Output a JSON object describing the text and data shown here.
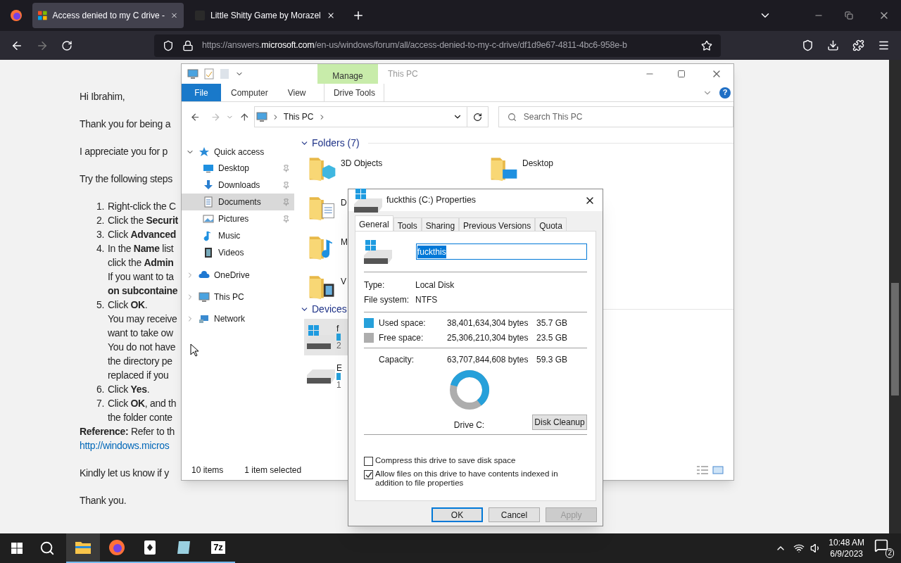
{
  "browser": {
    "tabs": [
      {
        "title": "Access denied to my C drive -",
        "selected": true,
        "kind": "ms"
      },
      {
        "title": "Little Shitty Game by Morazel",
        "selected": false,
        "kind": "game"
      }
    ],
    "url": {
      "before": "https://answers.",
      "domain": "microsoft.com",
      "after": "/en-us/windows/forum/all/access-denied-to-my-c-drive/df1d9e67-4811-4bc6-958e-b"
    }
  },
  "article": [
    {
      "kind": "para",
      "text": "Hi Ibrahim,"
    },
    {
      "kind": "para",
      "text": "Thank you for being a"
    },
    {
      "kind": "para",
      "text": "I appreciate you for p"
    },
    {
      "kind": "para",
      "text": "Try the following steps"
    },
    {
      "kind": "list",
      "items": [
        {
          "number": "1.",
          "lines": [
            "Right-click the C"
          ]
        },
        {
          "number": "2.",
          "lines": [
            "Click the **Securit**"
          ]
        },
        {
          "number": "3.",
          "lines": [
            "Click **Advanced**"
          ]
        },
        {
          "number": "4.",
          "lines": [
            "In the **Name** list",
            "click the **Admin**",
            "If you want to ta",
            "**on subcontaine**"
          ]
        },
        {
          "number": "5.",
          "lines": [
            "Click **OK**.",
            "You may receive",
            "want to take ow",
            "You do not have",
            "the directory pe",
            "replaced if you"
          ]
        },
        {
          "number": "6.",
          "lines": [
            "Click **Yes**."
          ]
        },
        {
          "number": "7.",
          "lines": [
            "Click **OK**, and th",
            "the folder conte"
          ]
        }
      ]
    },
    {
      "kind": "tight",
      "text": "**Reference:** Refer to th"
    },
    {
      "kind": "link",
      "text": "http://windows.micros"
    },
    {
      "kind": "para",
      "text": "Kindly let us know if y"
    },
    {
      "kind": "para",
      "text": "Thank you."
    }
  ],
  "explorer": {
    "title": "This PC",
    "context_tab": "Manage",
    "help": "?",
    "ribbon_tabs": [
      {
        "label": "File",
        "kind": "file"
      },
      {
        "label": "Computer",
        "kind": "plain"
      },
      {
        "label": "View",
        "kind": "plain"
      },
      {
        "label": "Drive Tools",
        "kind": "context"
      }
    ],
    "address": "This PC",
    "search": {
      "placeholder": "Search This PC"
    },
    "nav": [
      {
        "label": "Quick access",
        "kind": "star",
        "expanded": true,
        "children": [
          {
            "label": "Desktop",
            "kind": "desktop",
            "pinned": true,
            "selected": false
          },
          {
            "label": "Downloads",
            "kind": "download",
            "pinned": true,
            "selected": false
          },
          {
            "label": "Documents",
            "kind": "documents",
            "pinned": true,
            "selected": true
          },
          {
            "label": "Pictures",
            "kind": "pictures",
            "pinned": true,
            "selected": false
          },
          {
            "label": "Music",
            "kind": "music",
            "pinned": false,
            "selected": false
          },
          {
            "label": "Videos",
            "kind": "videos",
            "pinned": false,
            "selected": false
          }
        ]
      },
      {
        "label": "OneDrive",
        "kind": "cloud",
        "expanded": false
      },
      {
        "label": "This PC",
        "kind": "pc",
        "expanded": false
      },
      {
        "label": "Network",
        "kind": "network",
        "expanded": false
      }
    ],
    "folders_header": "Folders (7)",
    "folder_rows": [
      [
        {
          "name": "3D Objects",
          "kind": "objects3d"
        },
        {
          "name": "Desktop",
          "kind": "desktop"
        }
      ],
      [
        {
          "name": "D",
          "kind": "documents"
        }
      ],
      [
        {
          "name": "M",
          "kind": "music"
        }
      ],
      [
        {
          "name": "V",
          "kind": "videos"
        }
      ]
    ],
    "devices_header": "Devices",
    "devices": [
      {
        "name": "f",
        "sub": "2",
        "kind": "windows",
        "selected": true
      },
      {
        "name": "E",
        "sub": "1",
        "kind": "plain",
        "selected": false
      }
    ],
    "status": [
      "10 items",
      "1 item selected"
    ]
  },
  "dialog": {
    "title": "fuckthis (C:) Properties",
    "tabs": [
      {
        "label": "General",
        "selected": true
      },
      {
        "label": "Tools",
        "selected": false
      },
      {
        "label": "Sharing",
        "selected": false
      },
      {
        "label": "Previous Versions",
        "selected": false
      },
      {
        "label": "Quota",
        "selected": false
      }
    ],
    "name": "fuckthis",
    "info": [
      {
        "label": "Type:",
        "value": "Local Disk"
      },
      {
        "label": "File system:",
        "value": "NTFS"
      }
    ],
    "space": [
      {
        "label": "Used space:",
        "bytes": "38,401,634,304 bytes",
        "size": "35.7 GB",
        "color": "#26a0da"
      },
      {
        "label": "Free space:",
        "bytes": "25,306,210,304 bytes",
        "size": "23.5 GB",
        "color": "#adadad"
      }
    ],
    "capacity": {
      "label": "Capacity:",
      "bytes": "63,707,844,608 bytes",
      "size": "59.3 GB"
    },
    "drive_label": "Drive C:",
    "cleanup": "Disk Cleanup",
    "options": [
      {
        "label": "Compress this drive to save disk space",
        "checked": false
      },
      {
        "label": "Allow files on this drive to have contents indexed in addition to file properties",
        "checked": true
      }
    ],
    "buttons": [
      {
        "label": "OK",
        "kind": "default",
        "disabled": false
      },
      {
        "label": "Cancel",
        "kind": "normal",
        "disabled": false
      },
      {
        "label": "Apply",
        "kind": "normal",
        "disabled": true
      }
    ]
  },
  "taskbar": {
    "apps": [
      {
        "kind": "explorer",
        "active": true
      },
      {
        "kind": "firefox",
        "active": false
      },
      {
        "kind": "cards",
        "active": false
      },
      {
        "kind": "notes",
        "active": false
      },
      {
        "kind": "archive",
        "label": "7z",
        "active": false
      }
    ],
    "time": "10:48 AM",
    "date": "6/9/2023",
    "notifications": "2"
  }
}
